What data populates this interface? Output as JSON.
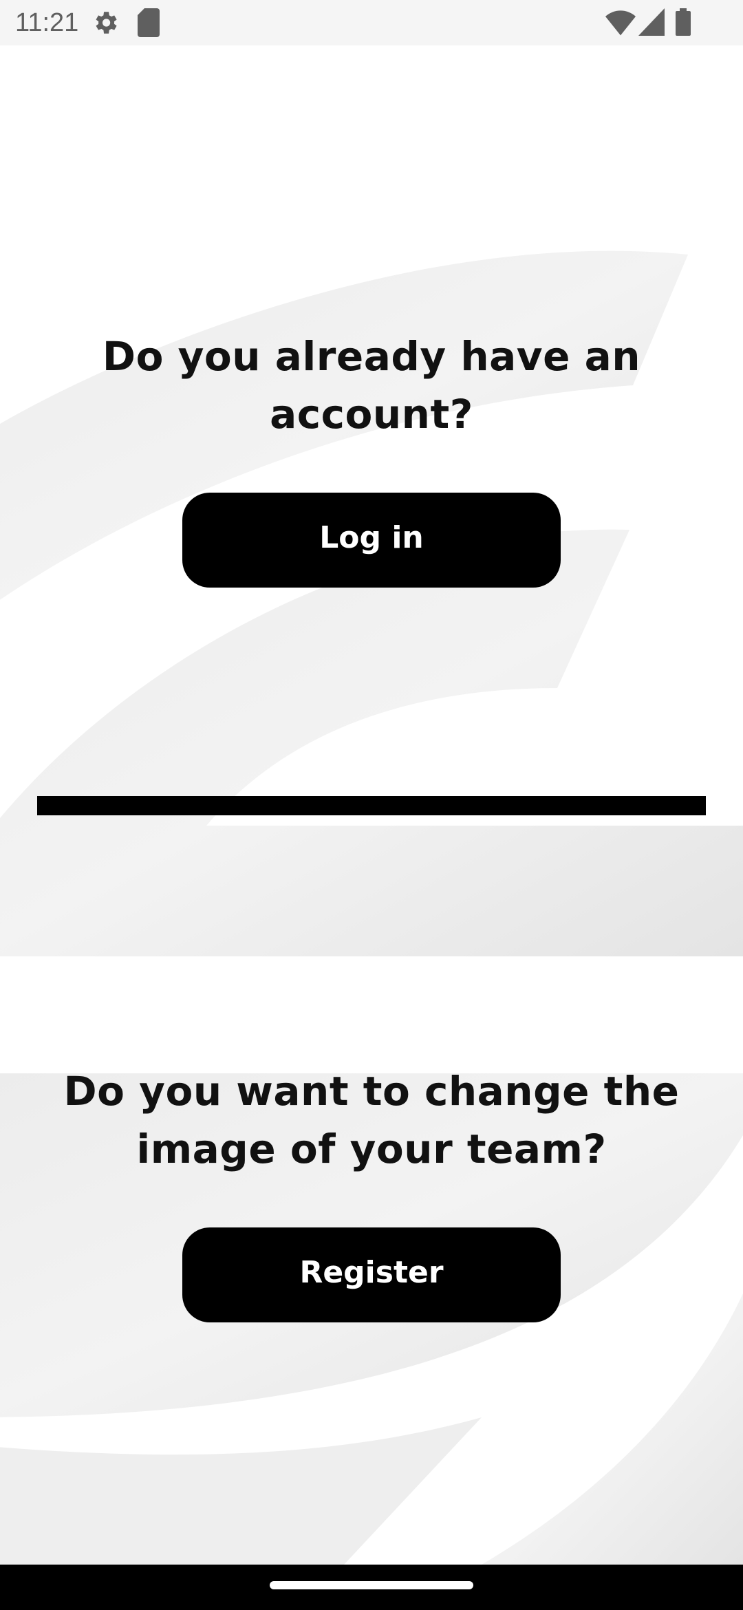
{
  "status_bar": {
    "time": "11:21",
    "left_icons": [
      "settings-gear-icon",
      "sd-card-icon"
    ],
    "right_icons": [
      "wifi-icon",
      "cell-signal-icon",
      "battery-icon"
    ]
  },
  "login_section": {
    "question": "Do you already have an account?",
    "button_label": "Log in"
  },
  "register_section": {
    "question": "Do you want to change the image of your team?",
    "button_label": "Register"
  },
  "colors": {
    "background": "#ffffff",
    "button": "#000000",
    "button_text": "#ffffff",
    "text": "#111111",
    "watermark": "#e6e6e6"
  }
}
